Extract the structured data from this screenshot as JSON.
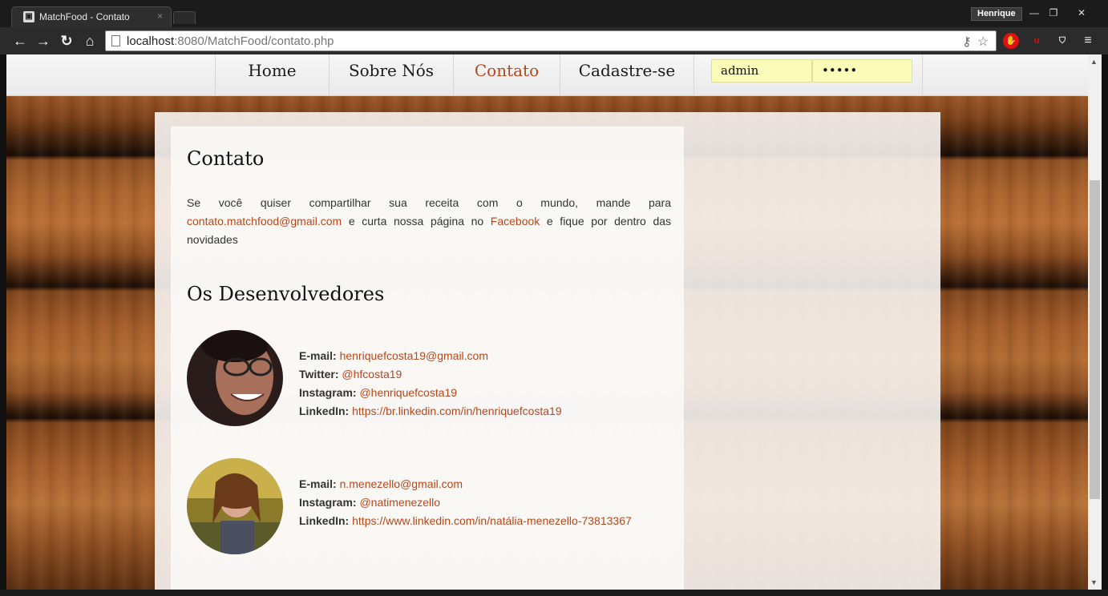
{
  "browser": {
    "tab_title": "MatchFood - Contato",
    "tab_close": "×",
    "profile_name": "Henrique",
    "url_host": "localhost",
    "url_rest": ":8080/MatchFood/contato.php",
    "window_minimize": "—",
    "window_restore": "❐",
    "window_close": "✕"
  },
  "nav": {
    "items": [
      {
        "label": "Home",
        "active": false
      },
      {
        "label": "Sobre Nós",
        "active": false
      },
      {
        "label": "Contato",
        "active": true
      },
      {
        "label": "Cadastre-se",
        "active": false
      }
    ],
    "username_value": "admin",
    "password_value": "•••••"
  },
  "contato": {
    "title": "Contato",
    "text_1": "Se você quiser compartilhar sua receita com o mundo, mande para",
    "email_link": "contato.matchfood@gmail.com",
    "text_2": "e curta nossa página no",
    "facebook_link": "Facebook",
    "text_3": "e fique por dentro das novidades"
  },
  "developers": {
    "title": "Os Desenvolvedores",
    "people": [
      {
        "email_label": "E-mail:",
        "email": "henriquefcosta19@gmail.com",
        "twitter_label": "Twitter:",
        "twitter": "@hfcosta19",
        "instagram_label": "Instagram:",
        "instagram": "@henriquefcosta19",
        "linkedin_label": "LinkedIn:",
        "linkedin": "https://br.linkedin.com/in/henriquefcosta19"
      },
      {
        "email_label": "E-mail:",
        "email": "n.menezello@gmail.com",
        "instagram_label": "Instagram:",
        "instagram": "@natimenezello",
        "linkedin_label": "LinkedIn:",
        "linkedin": "https://www.linkedin.com/in/natália-menezello-73813367"
      }
    ]
  },
  "colors": {
    "accent": "#b5471b",
    "login_field_bg": "#fafcb8"
  }
}
